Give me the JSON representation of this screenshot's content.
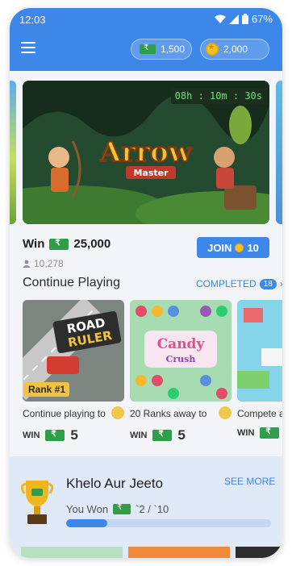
{
  "status_bar": {
    "time": "12:03",
    "battery": "67%"
  },
  "header": {
    "cash_balance": "1,500",
    "coin_balance": "2,000",
    "icons": [
      "menu-icon",
      "rupee-note-icon",
      "coin-icon"
    ]
  },
  "banner": {
    "timer": "08h : 10m : 30s",
    "win_label": "Win",
    "prize": "25,000",
    "players": "10,278",
    "join_label": "JOIN",
    "join_cost": "10",
    "logo_text": "Arrow",
    "logo_sub": "Master"
  },
  "continue_playing": {
    "title": "Continue Playing",
    "completed_label": "COMPLETED",
    "completed_count": "18",
    "cards": [
      {
        "logo": "ROAD",
        "logo2": "RULER",
        "tag": "Rank #1",
        "subtitle": "Continue playing to",
        "win_label": "WIN",
        "amount": "5"
      },
      {
        "logo": "Candy",
        "logo2": "Crush",
        "subtitle": "20 Ranks away to",
        "win_label": "WIN",
        "amount": "5"
      },
      {
        "subtitle": "Compete a",
        "win_label": "WIN"
      }
    ]
  },
  "khelo": {
    "title": "Khelo Aur Jeeto",
    "see_more": "SEE MORE",
    "you_won_label": "You Won",
    "you_won_value": "`2 / `10",
    "progress": 0.2
  },
  "colors": {
    "primary": "#3d87e8",
    "cash_green": "#2f9e48",
    "coin_gold": "#f5c026"
  }
}
